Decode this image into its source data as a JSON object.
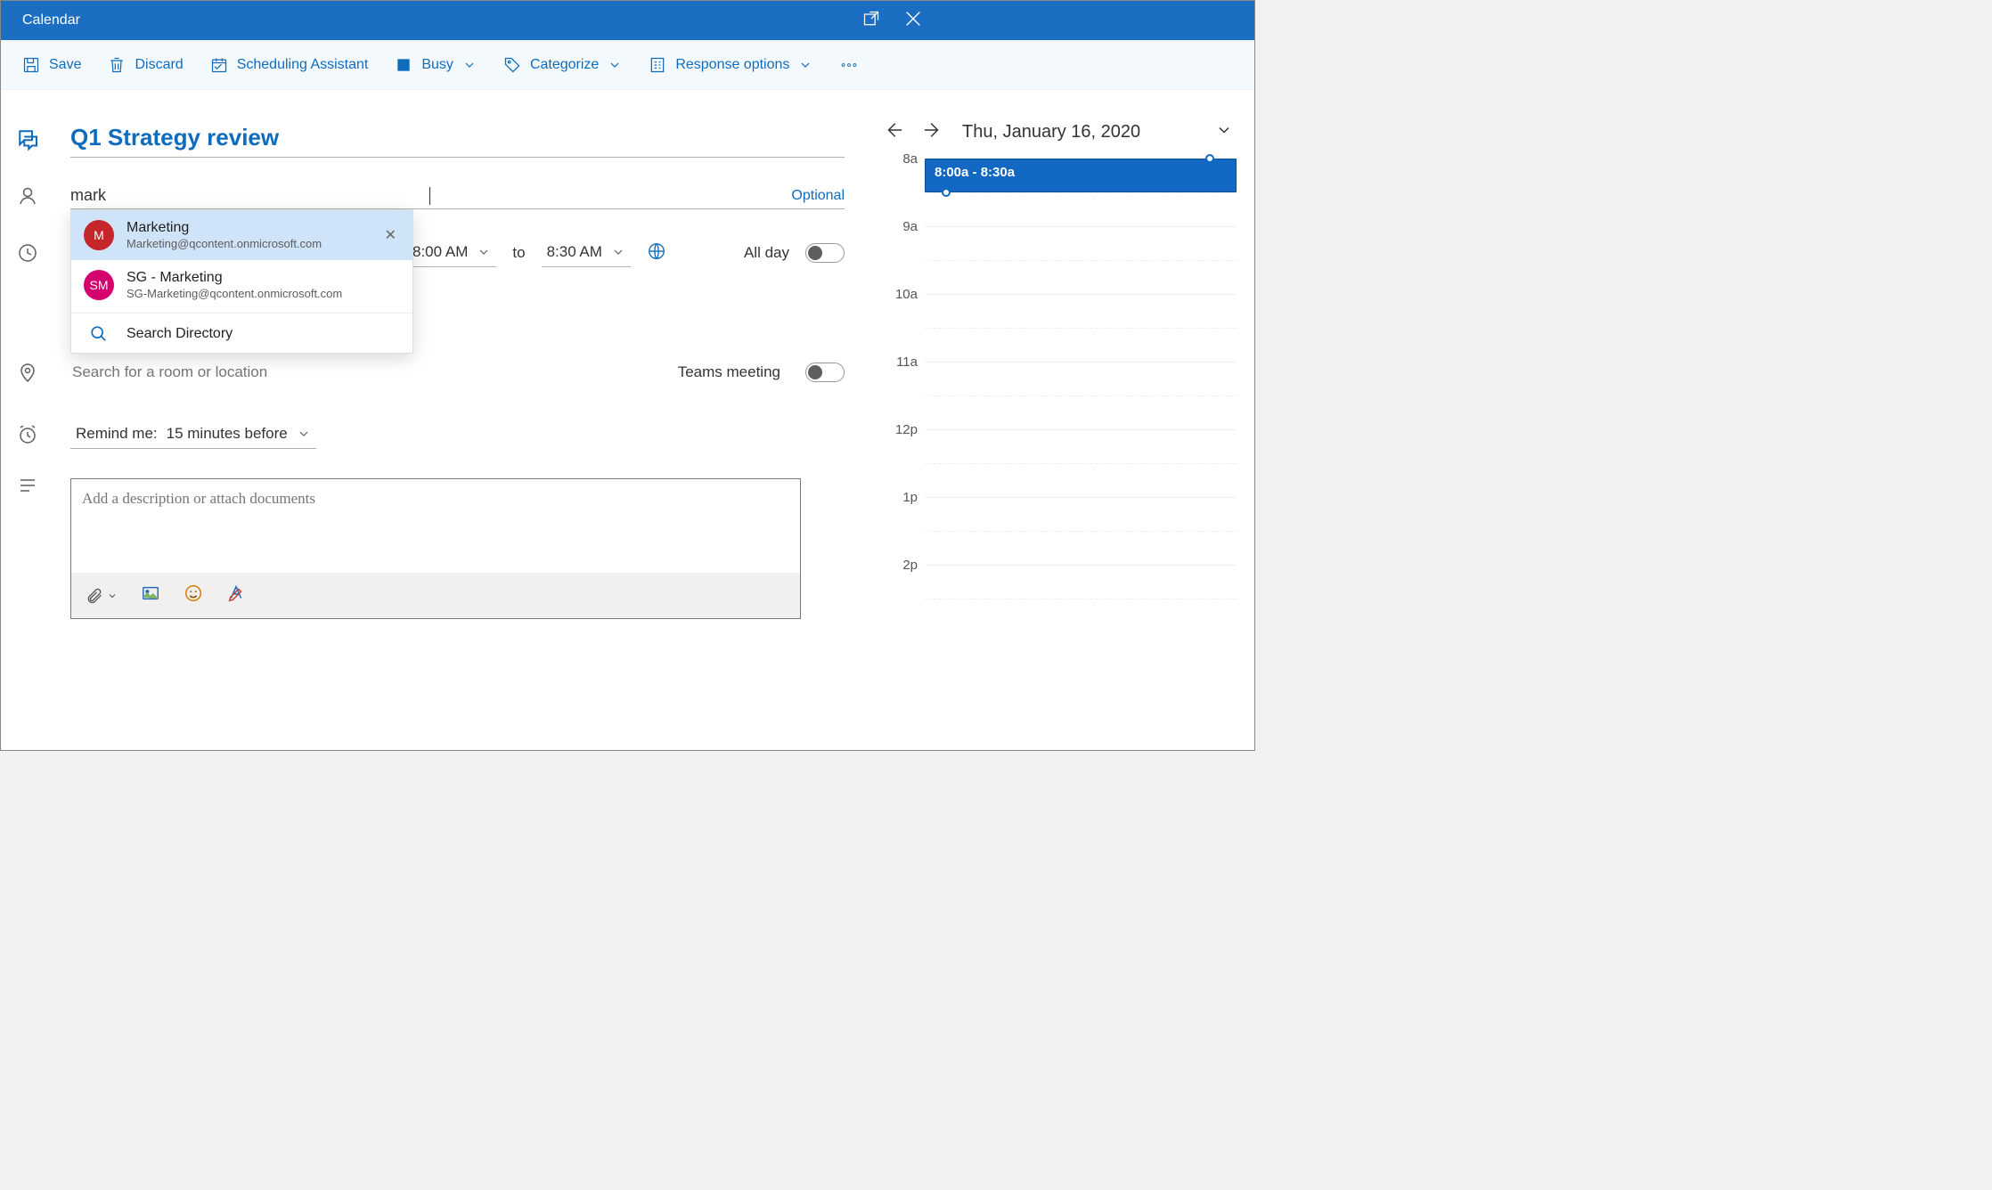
{
  "titlebar": {
    "title": "Calendar"
  },
  "toolbar": {
    "save": "Save",
    "discard": "Discard",
    "scheduling": "Scheduling Assistant",
    "busy": "Busy",
    "categorize": "Categorize",
    "response": "Response options"
  },
  "event": {
    "title": "Q1 Strategy review",
    "attendee_input": "mark",
    "optional": "Optional",
    "start_time": "8:00 AM",
    "to": "to",
    "end_time": "8:30 AM",
    "allday": "All day",
    "location_placeholder": "Search for a room or location",
    "teams_label": "Teams meeting",
    "remind_label": "Remind me:",
    "remind_value": "15 minutes before",
    "desc_placeholder": "Add a description or attach documents"
  },
  "suggestions": [
    {
      "initials": "M",
      "color": "#c5262a",
      "name": "Marketing",
      "email": "Marketing@qcontent.onmicrosoft.com",
      "selected": true
    },
    {
      "initials": "SM",
      "color": "#d4006d",
      "name": "SG - Marketing",
      "email": "SG-Marketing@qcontent.onmicrosoft.com",
      "selected": false
    }
  ],
  "search_dir": "Search Directory",
  "daypane": {
    "date": "Thu, January 16, 2020",
    "hours": [
      "8a",
      "9a",
      "10a",
      "11a",
      "12p",
      "1p",
      "2p"
    ],
    "event_label": "8:00a - 8:30a"
  }
}
